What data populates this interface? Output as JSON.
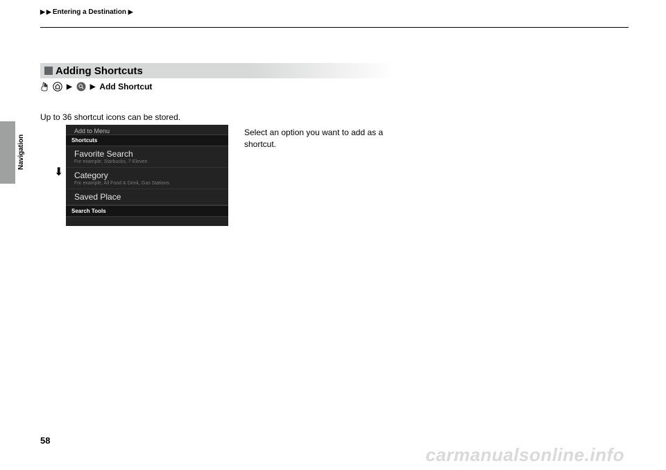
{
  "header": {
    "crumb": "Entering a Destination"
  },
  "side": {
    "label": "Navigation"
  },
  "section": {
    "title": "Adding Shortcuts"
  },
  "breadcrumb": {
    "last": "Add Shortcut"
  },
  "body": {
    "line1": "Up to 36 shortcut icons can be stored.",
    "line2": "Select an option you want to add as a shortcut."
  },
  "screenshot": {
    "title": "Add to Menu",
    "section1": "Shortcuts",
    "items": [
      {
        "title": "Favorite Search",
        "sub": "For example, Starbucks, 7-Eleven"
      },
      {
        "title": "Category",
        "sub": "For example, All Food & Drink, Gas Stations"
      },
      {
        "title": "Saved Place",
        "sub": ""
      }
    ],
    "section2": "Search Tools",
    "truncated": ""
  },
  "page_number": "58",
  "watermark": "carmanualsonline.info"
}
